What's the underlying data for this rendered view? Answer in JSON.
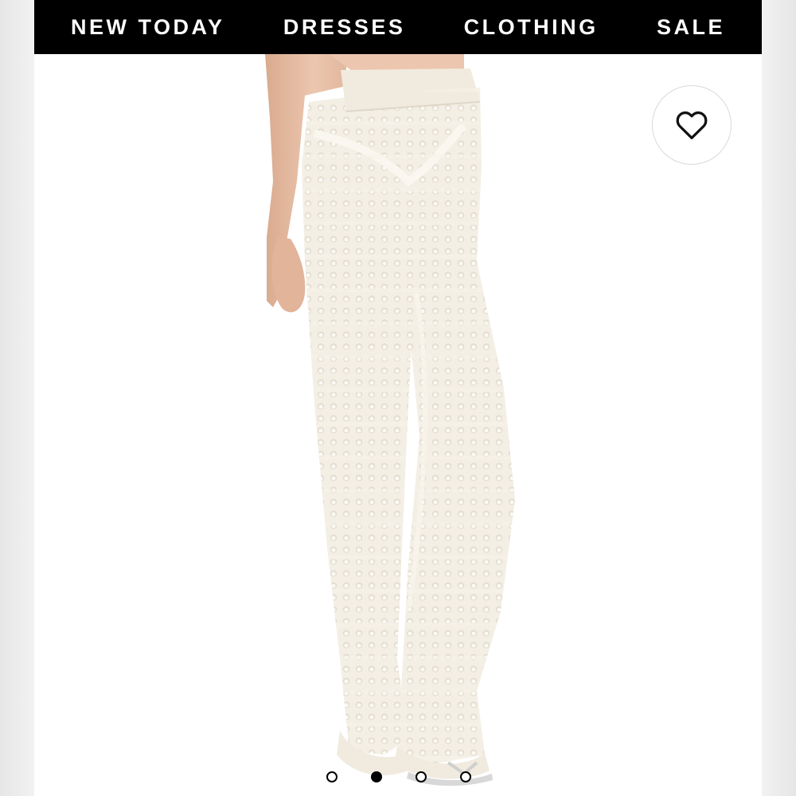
{
  "nav": {
    "items": [
      "NEW TODAY",
      "DRESSES",
      "CLOTHING",
      "SALE"
    ]
  },
  "product": {
    "wishlist_icon": "heart-outline-icon"
  },
  "carousel": {
    "slide_count": 4,
    "active_index": 1
  },
  "colors": {
    "nav_background": "#000000",
    "nav_text": "#ffffff",
    "accent": "#000000",
    "garment": "#f4efe4"
  }
}
